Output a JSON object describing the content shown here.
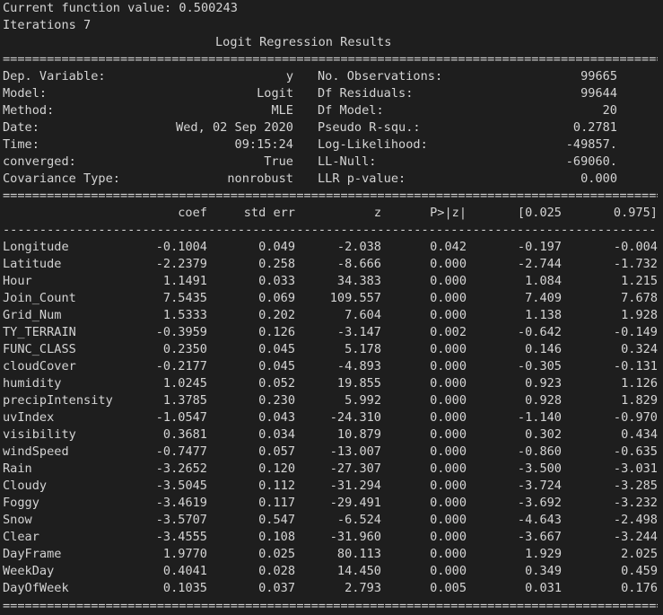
{
  "header": {
    "current_function_value": "Current function value: 0.500243",
    "iterations": "Iterations 7",
    "title": "Logit Regression Results"
  },
  "separators": {
    "double": "===============================================================================================================",
    "single": "-------------------------------------------------------------------------------------------------------------------"
  },
  "summary_left": [
    {
      "label": "Dep. Variable:",
      "value": "y"
    },
    {
      "label": "Model:",
      "value": "Logit"
    },
    {
      "label": "Method:",
      "value": "MLE"
    },
    {
      "label": "Date:",
      "value": "Wed, 02 Sep 2020"
    },
    {
      "label": "Time:",
      "value": "09:15:24"
    },
    {
      "label": "converged:",
      "value": "True"
    },
    {
      "label": "Covariance Type:",
      "value": "nonrobust"
    }
  ],
  "summary_right": [
    {
      "label": "No. Observations:",
      "value": "99665"
    },
    {
      "label": "Df Residuals:",
      "value": "99644"
    },
    {
      "label": "Df Model:",
      "value": "20"
    },
    {
      "label": "Pseudo R-squ.:",
      "value": "0.2781"
    },
    {
      "label": "Log-Likelihood:",
      "value": "-49857."
    },
    {
      "label": "LL-Null:",
      "value": "-69060."
    },
    {
      "label": "LLR p-value:",
      "value": "0.000"
    }
  ],
  "coef_headers": {
    "coef": "coef",
    "std_err": "std err",
    "z": "z",
    "p": "P>|z|",
    "ci_low": "[0.025",
    "ci_high": "0.975]"
  },
  "coef_rows": [
    {
      "name": "Longitude",
      "coef": "-0.1004",
      "std_err": "0.049",
      "z": "-2.038",
      "p": "0.042",
      "ci_low": "-0.197",
      "ci_high": "-0.004"
    },
    {
      "name": "Latitude",
      "coef": "-2.2379",
      "std_err": "0.258",
      "z": "-8.666",
      "p": "0.000",
      "ci_low": "-2.744",
      "ci_high": "-1.732"
    },
    {
      "name": "Hour",
      "coef": "1.1491",
      "std_err": "0.033",
      "z": "34.383",
      "p": "0.000",
      "ci_low": "1.084",
      "ci_high": "1.215"
    },
    {
      "name": "Join_Count",
      "coef": "7.5435",
      "std_err": "0.069",
      "z": "109.557",
      "p": "0.000",
      "ci_low": "7.409",
      "ci_high": "7.678"
    },
    {
      "name": "Grid_Num",
      "coef": "1.5333",
      "std_err": "0.202",
      "z": "7.604",
      "p": "0.000",
      "ci_low": "1.138",
      "ci_high": "1.928"
    },
    {
      "name": "TY_TERRAIN",
      "coef": "-0.3959",
      "std_err": "0.126",
      "z": "-3.147",
      "p": "0.002",
      "ci_low": "-0.642",
      "ci_high": "-0.149"
    },
    {
      "name": "FUNC_CLASS",
      "coef": "0.2350",
      "std_err": "0.045",
      "z": "5.178",
      "p": "0.000",
      "ci_low": "0.146",
      "ci_high": "0.324"
    },
    {
      "name": "cloudCover",
      "coef": "-0.2177",
      "std_err": "0.045",
      "z": "-4.893",
      "p": "0.000",
      "ci_low": "-0.305",
      "ci_high": "-0.131"
    },
    {
      "name": "humidity",
      "coef": "1.0245",
      "std_err": "0.052",
      "z": "19.855",
      "p": "0.000",
      "ci_low": "0.923",
      "ci_high": "1.126"
    },
    {
      "name": "precipIntensity",
      "coef": "1.3785",
      "std_err": "0.230",
      "z": "5.992",
      "p": "0.000",
      "ci_low": "0.928",
      "ci_high": "1.829"
    },
    {
      "name": "uvIndex",
      "coef": "-1.0547",
      "std_err": "0.043",
      "z": "-24.310",
      "p": "0.000",
      "ci_low": "-1.140",
      "ci_high": "-0.970"
    },
    {
      "name": "visibility",
      "coef": "0.3681",
      "std_err": "0.034",
      "z": "10.879",
      "p": "0.000",
      "ci_low": "0.302",
      "ci_high": "0.434"
    },
    {
      "name": "windSpeed",
      "coef": "-0.7477",
      "std_err": "0.057",
      "z": "-13.007",
      "p": "0.000",
      "ci_low": "-0.860",
      "ci_high": "-0.635"
    },
    {
      "name": "Rain",
      "coef": "-3.2652",
      "std_err": "0.120",
      "z": "-27.307",
      "p": "0.000",
      "ci_low": "-3.500",
      "ci_high": "-3.031"
    },
    {
      "name": "Cloudy",
      "coef": "-3.5045",
      "std_err": "0.112",
      "z": "-31.294",
      "p": "0.000",
      "ci_low": "-3.724",
      "ci_high": "-3.285"
    },
    {
      "name": "Foggy",
      "coef": "-3.4619",
      "std_err": "0.117",
      "z": "-29.491",
      "p": "0.000",
      "ci_low": "-3.692",
      "ci_high": "-3.232"
    },
    {
      "name": "Snow",
      "coef": "-3.5707",
      "std_err": "0.547",
      "z": "-6.524",
      "p": "0.000",
      "ci_low": "-4.643",
      "ci_high": "-2.498"
    },
    {
      "name": "Clear",
      "coef": "-3.4555",
      "std_err": "0.108",
      "z": "-31.960",
      "p": "0.000",
      "ci_low": "-3.667",
      "ci_high": "-3.244"
    },
    {
      "name": "DayFrame",
      "coef": "1.9770",
      "std_err": "0.025",
      "z": "80.113",
      "p": "0.000",
      "ci_low": "1.929",
      "ci_high": "2.025"
    },
    {
      "name": "WeekDay",
      "coef": "0.4041",
      "std_err": "0.028",
      "z": "14.450",
      "p": "0.000",
      "ci_low": "0.349",
      "ci_high": "0.459"
    },
    {
      "name": "DayOfWeek",
      "coef": "0.1035",
      "std_err": "0.037",
      "z": "2.793",
      "p": "0.005",
      "ci_low": "0.031",
      "ci_high": "0.176"
    }
  ]
}
